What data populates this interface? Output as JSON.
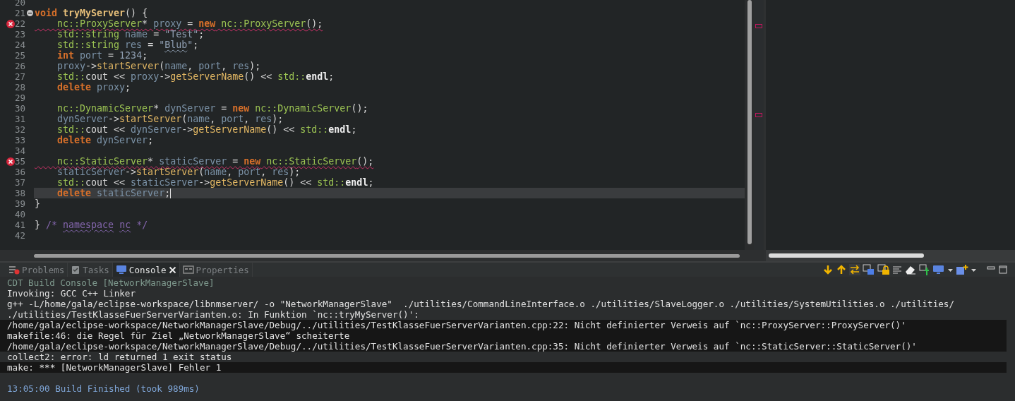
{
  "editor": {
    "lines": [
      {
        "number": "20",
        "error": false,
        "current": false,
        "foldable": false
      },
      {
        "number": "21",
        "error": false,
        "current": false,
        "foldable": true,
        "tokens": [
          {
            "kind": "keyword",
            "text": "void"
          },
          {
            "kind": "declaration",
            "text": " tryMyServer"
          },
          {
            "kind": "plain",
            "text": "() {"
          }
        ]
      },
      {
        "number": "22",
        "error": true,
        "current": false,
        "foldable": false,
        "tokens": [
          {
            "kind": "type",
            "text": "    nc::ProxyServer"
          },
          {
            "kind": "plain",
            "text": "* "
          },
          {
            "kind": "variable",
            "text": "proxy"
          },
          {
            "kind": "plain",
            "text": " = "
          },
          {
            "kind": "keyword",
            "text": "new"
          },
          {
            "kind": "type",
            "text": " nc::ProxyServer"
          },
          {
            "kind": "plain",
            "text": "();"
          }
        ]
      },
      {
        "number": "23",
        "error": false,
        "current": false,
        "foldable": false,
        "tokens": [
          {
            "kind": "type",
            "text": "    std::string"
          },
          {
            "kind": "variable",
            "text": " name"
          },
          {
            "kind": "plain",
            "text": " = "
          },
          {
            "kind": "string",
            "text": "\"Test\""
          },
          {
            "kind": "plain",
            "text": ";"
          }
        ]
      },
      {
        "number": "24",
        "error": false,
        "current": false,
        "foldable": false,
        "tokens": [
          {
            "kind": "type",
            "text": "    std::string"
          },
          {
            "kind": "variable",
            "text": " res"
          },
          {
            "kind": "plain",
            "text": " = "
          },
          {
            "kind": "string",
            "text": "\""
          },
          {
            "kind": "string",
            "text": "Blub",
            "misspelled": true
          },
          {
            "kind": "string",
            "text": "\""
          },
          {
            "kind": "plain",
            "text": ";"
          }
        ]
      },
      {
        "number": "25",
        "error": false,
        "current": false,
        "foldable": false,
        "tokens": [
          {
            "kind": "keyword",
            "text": "    int"
          },
          {
            "kind": "variable",
            "text": " port"
          },
          {
            "kind": "plain",
            "text": " = "
          },
          {
            "kind": "string",
            "text": "1234"
          },
          {
            "kind": "plain",
            "text": ";"
          }
        ]
      },
      {
        "number": "26",
        "error": false,
        "current": false,
        "foldable": false,
        "tokens": [
          {
            "kind": "variable",
            "text": "    proxy"
          },
          {
            "kind": "plain",
            "text": "->"
          },
          {
            "kind": "function",
            "text": "startServer"
          },
          {
            "kind": "plain",
            "text": "("
          },
          {
            "kind": "variable",
            "text": "name"
          },
          {
            "kind": "plain",
            "text": ", "
          },
          {
            "kind": "variable",
            "text": "port"
          },
          {
            "kind": "plain",
            "text": ", "
          },
          {
            "kind": "variable",
            "text": "res"
          },
          {
            "kind": "plain",
            "text": ");"
          }
        ]
      },
      {
        "number": "27",
        "error": false,
        "current": false,
        "foldable": false,
        "tokens": [
          {
            "kind": "type",
            "text": "    std::"
          },
          {
            "kind": "plain",
            "text": "cout << "
          },
          {
            "kind": "variable",
            "text": "proxy"
          },
          {
            "kind": "plain",
            "text": "->"
          },
          {
            "kind": "function",
            "text": "getServerName"
          },
          {
            "kind": "plain",
            "text": "() << "
          },
          {
            "kind": "type",
            "text": "std::"
          },
          {
            "kind": "bold",
            "text": "endl"
          },
          {
            "kind": "plain",
            "text": ";"
          }
        ]
      },
      {
        "number": "28",
        "error": false,
        "current": false,
        "foldable": false,
        "tokens": [
          {
            "kind": "keyword",
            "text": "    delete"
          },
          {
            "kind": "variable",
            "text": " proxy"
          },
          {
            "kind": "plain",
            "text": ";"
          }
        ]
      },
      {
        "number": "29",
        "error": false,
        "current": false,
        "foldable": false
      },
      {
        "number": "30",
        "error": false,
        "current": false,
        "foldable": false,
        "tokens": [
          {
            "kind": "type",
            "text": "    nc::DynamicServer"
          },
          {
            "kind": "plain",
            "text": "* "
          },
          {
            "kind": "variable",
            "text": "dynServer"
          },
          {
            "kind": "plain",
            "text": " = "
          },
          {
            "kind": "keyword",
            "text": "new"
          },
          {
            "kind": "type",
            "text": " nc::DynamicServer"
          },
          {
            "kind": "plain",
            "text": "();"
          }
        ]
      },
      {
        "number": "31",
        "error": false,
        "current": false,
        "foldable": false,
        "tokens": [
          {
            "kind": "variable",
            "text": "    dynServer"
          },
          {
            "kind": "plain",
            "text": "->"
          },
          {
            "kind": "function",
            "text": "startServer"
          },
          {
            "kind": "plain",
            "text": "("
          },
          {
            "kind": "variable",
            "text": "name"
          },
          {
            "kind": "plain",
            "text": ", "
          },
          {
            "kind": "variable",
            "text": "port"
          },
          {
            "kind": "plain",
            "text": ", "
          },
          {
            "kind": "variable",
            "text": "res"
          },
          {
            "kind": "plain",
            "text": ");"
          }
        ]
      },
      {
        "number": "32",
        "error": false,
        "current": false,
        "foldable": false,
        "tokens": [
          {
            "kind": "type",
            "text": "    std::"
          },
          {
            "kind": "plain",
            "text": "cout << "
          },
          {
            "kind": "variable",
            "text": "dynServer"
          },
          {
            "kind": "plain",
            "text": "->"
          },
          {
            "kind": "function",
            "text": "getServerName"
          },
          {
            "kind": "plain",
            "text": "() << "
          },
          {
            "kind": "type",
            "text": "std::"
          },
          {
            "kind": "bold",
            "text": "endl"
          },
          {
            "kind": "plain",
            "text": ";"
          }
        ]
      },
      {
        "number": "33",
        "error": false,
        "current": false,
        "foldable": false,
        "tokens": [
          {
            "kind": "keyword",
            "text": "    delete"
          },
          {
            "kind": "variable",
            "text": " dynServer"
          },
          {
            "kind": "plain",
            "text": ";"
          }
        ]
      },
      {
        "number": "34",
        "error": false,
        "current": false,
        "foldable": false
      },
      {
        "number": "35",
        "error": true,
        "current": false,
        "foldable": false,
        "tokens": [
          {
            "kind": "type",
            "text": "    nc::StaticServer"
          },
          {
            "kind": "plain",
            "text": "* "
          },
          {
            "kind": "variable",
            "text": "staticServer"
          },
          {
            "kind": "plain",
            "text": " = "
          },
          {
            "kind": "keyword",
            "text": "new"
          },
          {
            "kind": "type",
            "text": " nc::StaticServer"
          },
          {
            "kind": "plain",
            "text": "();"
          }
        ]
      },
      {
        "number": "36",
        "error": false,
        "current": false,
        "foldable": false,
        "tokens": [
          {
            "kind": "variable",
            "text": "    staticServer"
          },
          {
            "kind": "plain",
            "text": "->"
          },
          {
            "kind": "function",
            "text": "startServer"
          },
          {
            "kind": "plain",
            "text": "("
          },
          {
            "kind": "variable",
            "text": "name"
          },
          {
            "kind": "plain",
            "text": ", "
          },
          {
            "kind": "variable",
            "text": "port"
          },
          {
            "kind": "plain",
            "text": ", "
          },
          {
            "kind": "variable",
            "text": "res"
          },
          {
            "kind": "plain",
            "text": ");"
          }
        ]
      },
      {
        "number": "37",
        "error": false,
        "current": false,
        "foldable": false,
        "tokens": [
          {
            "kind": "type",
            "text": "    std::"
          },
          {
            "kind": "plain",
            "text": "cout << "
          },
          {
            "kind": "variable",
            "text": "staticServer"
          },
          {
            "kind": "plain",
            "text": "->"
          },
          {
            "kind": "function",
            "text": "getServerName"
          },
          {
            "kind": "plain",
            "text": "() << "
          },
          {
            "kind": "type",
            "text": "std::"
          },
          {
            "kind": "bold",
            "text": "endl"
          },
          {
            "kind": "plain",
            "text": ";"
          }
        ]
      },
      {
        "number": "38",
        "error": false,
        "current": true,
        "foldable": false,
        "tokens": [
          {
            "kind": "keyword",
            "text": "    delete"
          },
          {
            "kind": "variable",
            "text": " staticServer"
          },
          {
            "kind": "plain",
            "text": ";"
          }
        ]
      },
      {
        "number": "39",
        "error": false,
        "current": false,
        "foldable": false,
        "tokens": [
          {
            "kind": "plain",
            "text": "}"
          }
        ]
      },
      {
        "number": "40",
        "error": false,
        "current": false,
        "foldable": false
      },
      {
        "number": "41",
        "error": false,
        "current": false,
        "foldable": false,
        "tokens": [
          {
            "kind": "plain",
            "text": "}"
          },
          {
            "kind": "comment",
            "text": " /* "
          },
          {
            "kind": "comment",
            "text": "namespace",
            "misspelled": true
          },
          {
            "kind": "comment",
            "text": " nc",
            "misspelled": true
          },
          {
            "kind": "comment",
            "text": " */"
          }
        ]
      },
      {
        "number": "42",
        "error": false,
        "current": false,
        "foldable": false
      }
    ]
  },
  "panel": {
    "tabs": [
      {
        "kind": "problems",
        "label": "Problems",
        "selected": false
      },
      {
        "kind": "tasks",
        "label": "Tasks",
        "selected": false
      },
      {
        "kind": "console",
        "label": "Console",
        "selected": true
      },
      {
        "kind": "properties",
        "label": "Properties",
        "selected": false
      }
    ],
    "console": {
      "title": "CDT Build Console [NetworkManagerSlave]",
      "lines": [
        {
          "kind": "normal",
          "text": "Invoking: GCC C++ Linker"
        },
        {
          "kind": "normal",
          "text": "g++ -L/home/gala/eclipse-workspace/libnmserver/ -o \"NetworkManagerSlave\"  ./utilities/CommandLineInterface.o ./utilities/SlaveLogger.o ./utilities/SystemUtilities.o ./utilities/"
        },
        {
          "kind": "normal",
          "text": "./utilities/TestKlasseFuerServerVarianten.o: In Funktion `nc::tryMyServer()':"
        },
        {
          "kind": "error",
          "text": "/home/gala/eclipse-workspace/NetworkManagerSlave/Debug/../utilities/TestKlasseFuerServerVarianten.cpp:22: Nicht definierter Verweis auf `nc::ProxyServer::ProxyServer()'"
        },
        {
          "kind": "error",
          "text": "makefile:46: die Regel für Ziel „NetworkManagerSlave“ scheiterte"
        },
        {
          "kind": "error",
          "text": "/home/gala/eclipse-workspace/NetworkManagerSlave/Debug/../utilities/TestKlasseFuerServerVarianten.cpp:35: Nicht definierter Verweis auf `nc::StaticServer::StaticServer()'"
        },
        {
          "kind": "normal",
          "text": "collect2: error: ld returned 1 exit status"
        },
        {
          "kind": "error",
          "text": "make: *** [NetworkManagerSlave] Fehler 1"
        },
        {
          "kind": "info",
          "text": "13:05:00 Build Finished (took 989ms)"
        }
      ]
    }
  }
}
